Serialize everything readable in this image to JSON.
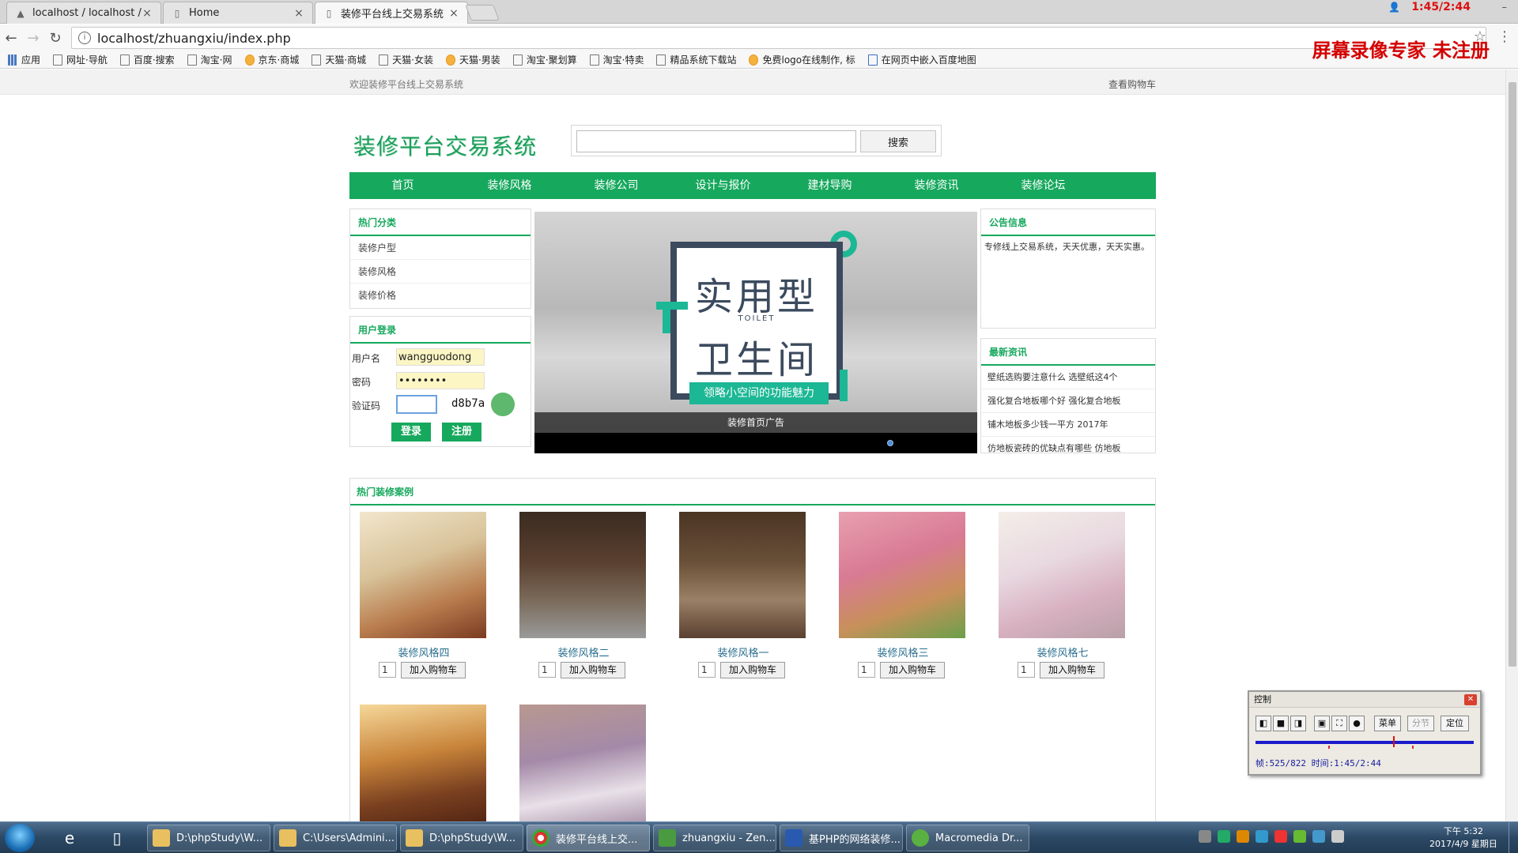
{
  "browser": {
    "tabs": [
      {
        "title": "localhost / localhost / ..."
      },
      {
        "title": "Home"
      },
      {
        "title": "装修平台线上交易系统"
      }
    ],
    "url": "localhost/zhuangxiu/index.php",
    "recording_time": "1:45/2:44",
    "bookmarks": [
      "应用",
      "网址·导航",
      "百度·搜索",
      "淘宝·网",
      "京东·商城",
      "天猫·商城",
      "天猫·女装",
      "天猫·男装",
      "淘宝·聚划算",
      "淘宝·特卖",
      "精品系统下载站",
      "免费logo在线制作, 标",
      "在网页中嵌入百度地图"
    ]
  },
  "watermark": "屏幕录像专家  未注册",
  "site": {
    "welcome": "欢迎装修平台线上交易系统",
    "cart_link": "查看购物车",
    "logo": "装修平台交易系统",
    "search_button": "搜索",
    "nav": [
      "首页",
      "装修风格",
      "装修公司",
      "设计与报价",
      "建材导购",
      "装修资讯",
      "装修论坛"
    ],
    "hot_categories": {
      "title": "热门分类",
      "items": [
        "装修户型",
        "装修风格",
        "装修价格"
      ]
    },
    "login": {
      "title": "用户登录",
      "username_label": "用户名",
      "username_value": "wangguodong",
      "password_label": "密码",
      "password_value": "••••••••",
      "captcha_label": "验证码",
      "captcha_code": "d8b7a",
      "login_button": "登录",
      "register_button": "注册"
    },
    "banner": {
      "line1": "实用型",
      "line2": "TOILET",
      "line3": "卫生间",
      "slogan": "领略小空间的功能魅力",
      "caption": "装修首页广告"
    },
    "notice": {
      "title": "公告信息",
      "text": "专修线上交易系统，天天优惠，天天实惠。"
    },
    "news": {
      "title": "最新资讯",
      "items": [
        "壁纸选购要注意什么 选壁纸这4个",
        "强化复合地板哪个好 强化复合地板",
        "铺木地板多少钱一平方 2017年",
        "仿地板瓷砖的优缺点有哪些 仿地板"
      ]
    },
    "cases": {
      "title": "热门装修案例",
      "add_cart_label": "加入购物车",
      "items": [
        {
          "name": "装修风格四",
          "qty": "1"
        },
        {
          "name": "装修风格二",
          "qty": "1"
        },
        {
          "name": "装修风格一",
          "qty": "1"
        },
        {
          "name": "装修风格三",
          "qty": "1"
        },
        {
          "name": "装修风格七",
          "qty": "1"
        }
      ]
    }
  },
  "control_panel": {
    "title": "控制",
    "menu": "菜单",
    "section": "分节",
    "locate": "定位",
    "info": "帧:525/822 时间:1:45/2:44"
  },
  "taskbar": {
    "tasks": [
      "D:\\phpStudy\\W...",
      "C:\\Users\\Admini...",
      "D:\\phpStudy\\W...",
      "装修平台线上交...",
      "zhuangxiu - Zen...",
      "基PHP的网络装修...",
      "Macromedia Dr..."
    ],
    "clock_time": "下午 5:32",
    "clock_date": "2017/4/9 星期日"
  },
  "colors": {
    "brand_green": "#16a85d",
    "banner_teal": "#1cb795",
    "watermark_red": "#d40000"
  }
}
